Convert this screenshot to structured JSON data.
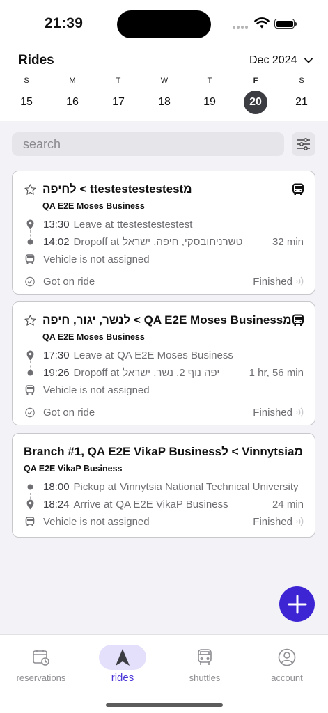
{
  "status_bar": {
    "time": "21:39"
  },
  "header": {
    "title": "Rides",
    "month": "Dec 2024"
  },
  "week": [
    {
      "letter": "S",
      "num": "15",
      "selected": false
    },
    {
      "letter": "M",
      "num": "16",
      "selected": false
    },
    {
      "letter": "T",
      "num": "17",
      "selected": false
    },
    {
      "letter": "W",
      "num": "18",
      "selected": false
    },
    {
      "letter": "T",
      "num": "19",
      "selected": false
    },
    {
      "letter": "F",
      "num": "20",
      "selected": true
    },
    {
      "letter": "S",
      "num": "21",
      "selected": false
    }
  ],
  "search": {
    "placeholder": "search"
  },
  "rides": [
    {
      "title": "לחיפה < ttestestestestestמ",
      "company": "QA E2E Moses Business",
      "start": {
        "time": "13:30",
        "label": "Leave at",
        "place": "ttestestestestest"
      },
      "end": {
        "time": "14:02",
        "label": "Dropoff at",
        "place": "טשרניחובסקי, חיפה, ישראל"
      },
      "duration": "32 min",
      "vehicle": "Vehicle is not assigned",
      "ride_status": "Got on ride",
      "trip_status": "Finished"
    },
    {
      "title": "לנשר, יגור, חיפה < QA E2E Moses Businessמ",
      "company": "QA E2E Moses Business",
      "start": {
        "time": "17:30",
        "label": "Leave at",
        "place": "QA E2E Moses Business"
      },
      "end": {
        "time": "19:26",
        "label": "Dropoff at",
        "place": "יפה נוף 2, נשר, ישראל"
      },
      "duration": "1 hr, 56 min",
      "vehicle": "Vehicle is not assigned",
      "ride_status": "Got on ride",
      "trip_status": "Finished"
    },
    {
      "title": "Branch #1, QA E2E VikaP Businessל < Vinnytsiaמ",
      "company": "QA E2E VikaP Business",
      "start": {
        "time": "18:00",
        "label": "Pickup at",
        "place": "Vinnytsia National Technical University"
      },
      "end": {
        "time": "18:24",
        "label": "Arrive at",
        "place": "QA E2E VikaP Business"
      },
      "duration": "24 min",
      "vehicle": "Vehicle is not assigned",
      "trip_status": "Finished"
    }
  ],
  "tabs": [
    {
      "label": "reservations",
      "icon": "calendar-clock-icon",
      "active": false
    },
    {
      "label": "rides",
      "icon": "navigation-arrow-icon",
      "active": true
    },
    {
      "label": "shuttles",
      "icon": "bus-icon",
      "active": false
    },
    {
      "label": "account",
      "icon": "user-circle-icon",
      "active": false
    }
  ],
  "colors": {
    "accent": "#3d25d4",
    "selected_day": "#3c3c43",
    "background": "#f2f2f7"
  }
}
